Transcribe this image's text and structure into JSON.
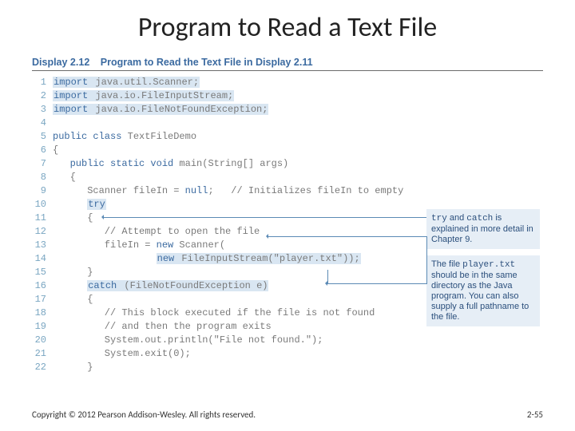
{
  "title": "Program to Read a Text File",
  "display": {
    "label": "Display 2.12",
    "title": "Program to Read the Text File in Display 2.11"
  },
  "code": [
    {
      "n": "1",
      "pre": "",
      "kw": "import",
      "rest": " java.util.Scanner;",
      "hl": true
    },
    {
      "n": "2",
      "pre": "",
      "kw": "import",
      "rest": " java.io.FileInputStream;",
      "hl": true
    },
    {
      "n": "3",
      "pre": "",
      "kw": "import",
      "rest": " java.io.FileNotFoundException;",
      "hl": true
    },
    {
      "n": "4",
      "pre": "",
      "kw": "",
      "rest": ""
    },
    {
      "n": "5",
      "pre": "",
      "kw": "public class",
      "rest": " TextFileDemo"
    },
    {
      "n": "6",
      "pre": "",
      "kw": "",
      "rest": "{"
    },
    {
      "n": "7",
      "pre": "   ",
      "kw": "public static void",
      "rest": " main(String[] args)"
    },
    {
      "n": "8",
      "pre": "   ",
      "kw": "",
      "rest": "{"
    },
    {
      "n": "9",
      "pre": "      ",
      "kw": "",
      "rest": "Scanner fileIn = ",
      "kw2": "null",
      "rest2": ";   // Initializes fileIn to empty"
    },
    {
      "n": "10",
      "pre": "      ",
      "kw": "try",
      "rest": "",
      "hlkw": true
    },
    {
      "n": "11",
      "pre": "      ",
      "kw": "",
      "rest": "{"
    },
    {
      "n": "12",
      "pre": "         ",
      "kw": "",
      "rest": "// Attempt to open the file"
    },
    {
      "n": "13",
      "pre": "         ",
      "kw": "",
      "rest": "fileIn = ",
      "kw2": "new",
      "rest2": " Scanner("
    },
    {
      "n": "14",
      "pre": "                  ",
      "kw": "new",
      "rest": " FileInputStream(\"player.txt\"));",
      "hl": true
    },
    {
      "n": "15",
      "pre": "      ",
      "kw": "",
      "rest": "}"
    },
    {
      "n": "16",
      "pre": "      ",
      "kw": "catch",
      "rest": " (FileNotFoundException e)",
      "hlkw": true,
      "hl": true
    },
    {
      "n": "17",
      "pre": "      ",
      "kw": "",
      "rest": "{"
    },
    {
      "n": "18",
      "pre": "         ",
      "kw": "",
      "rest": "// This block executed if the file is not found"
    },
    {
      "n": "19",
      "pre": "         ",
      "kw": "",
      "rest": "// and then the program exits"
    },
    {
      "n": "20",
      "pre": "         ",
      "kw": "",
      "rest": "System.out.println(\"File not found.\");"
    },
    {
      "n": "21",
      "pre": "         ",
      "kw": "",
      "rest": "System.exit(0);"
    },
    {
      "n": "22",
      "pre": "      ",
      "kw": "",
      "rest": "}"
    }
  ],
  "notes": {
    "n1a": "try",
    "n1b": " and ",
    "n1c": "catch",
    "n1d": " is explained in more detail in Chapter 9.",
    "n2a": "The file ",
    "n2b": "player.txt",
    "n2c": " should be in the same directory as the Java program. You can also supply a full pathname to the file."
  },
  "footer": {
    "copyright": "Copyright © 2012 Pearson Addison-Wesley. All rights reserved.",
    "page": "2-55"
  }
}
